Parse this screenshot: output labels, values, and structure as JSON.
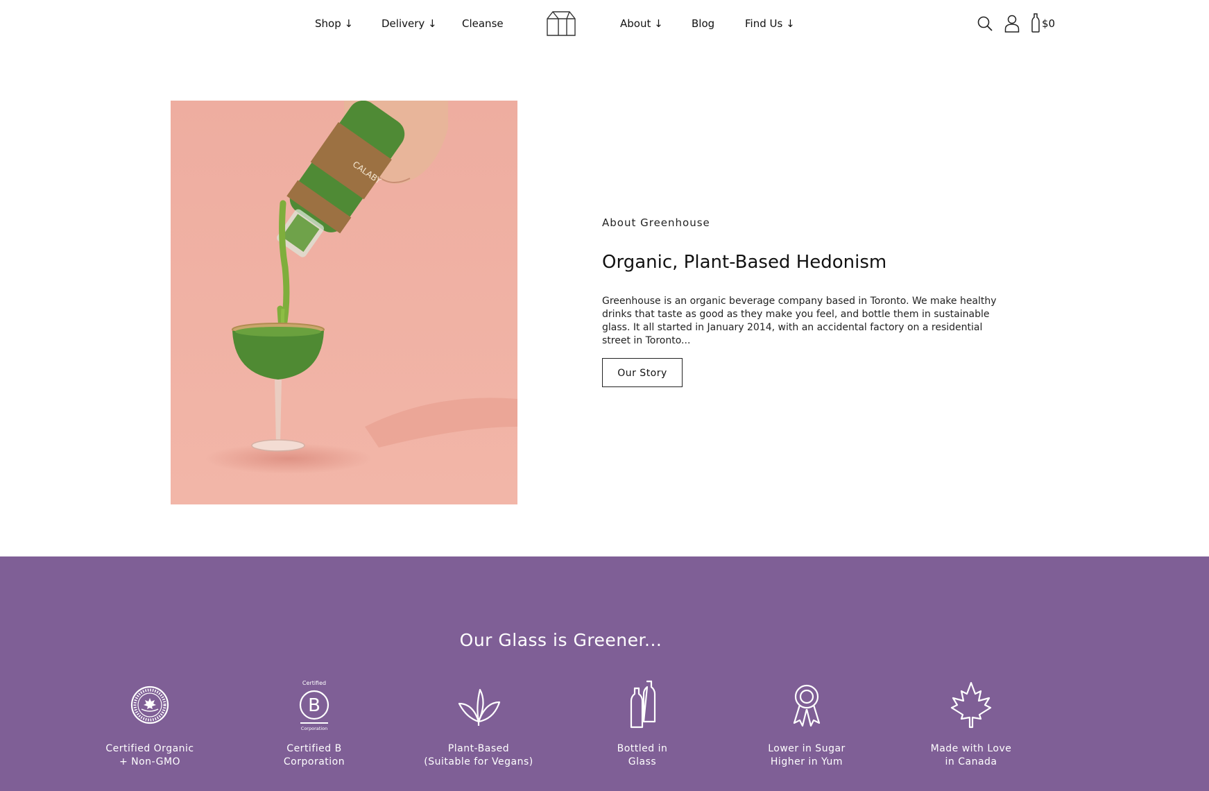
{
  "nav": {
    "left": [
      "Shop ↓",
      "Delivery ↓",
      "Cleanse"
    ],
    "right": [
      "About ↓",
      "Blog",
      "Find Us ↓"
    ],
    "cart_total": "$0",
    "icons": [
      "house-logo-icon",
      "search-icon",
      "user-icon",
      "bottle-cart-icon"
    ]
  },
  "about": {
    "eyebrow": "About Greenhouse",
    "headline": "Organic, Plant-Based Hedonism",
    "body": "Greenhouse is an organic beverage company based in Toronto. We make healthy drinks that taste as good as they make you feel, and bottle them in sustainable glass. It all started in January 2014, with an accidental factory on a residential street in Toronto...",
    "button": "Our Story"
  },
  "features": {
    "title": "Our Glass is Greener...",
    "items": [
      {
        "line1": "Certified Organic",
        "line2": "+ Non-GMO",
        "icon": "canada-organic-seal-icon"
      },
      {
        "line1": "Certified B",
        "line2": "Corporation",
        "icon": "b-corp-icon",
        "icon_text_top": "Certified",
        "icon_text_bottom": "Corporation",
        "icon_letter": "B"
      },
      {
        "line1": "Plant-Based",
        "line2": "(Suitable for Vegans)",
        "icon": "leaves-icon"
      },
      {
        "line1": "Bottled in",
        "line2": "Glass",
        "icon": "bottles-icon"
      },
      {
        "line1": "Lower in Sugar",
        "line2": "Higher in Yum",
        "icon": "ribbon-icon"
      },
      {
        "line1": "Made with Love",
        "line2": "in Canada",
        "icon": "maple-leaf-icon"
      }
    ]
  },
  "colors": {
    "band": "#7f5f96",
    "image_background": "#f0b2a4",
    "juice_green": "#5f9a37"
  }
}
